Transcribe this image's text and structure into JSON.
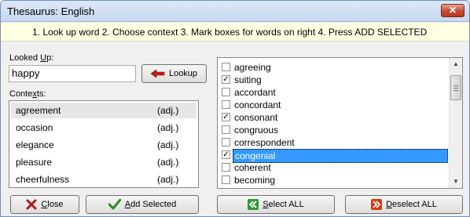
{
  "window": {
    "title": "Thesaurus: English",
    "close_glyph": "✕"
  },
  "instructions": "1. Look up word  2. Choose context  3. Mark boxes for words on right  4. Press ADD SELECTED",
  "lookup": {
    "label_pre": "Looked ",
    "label_key": "U",
    "label_post": "p:",
    "value": "happy",
    "button_label": "Lookup"
  },
  "contexts": {
    "label_pre": "Conte",
    "label_key": "x",
    "label_post": "ts:",
    "items": [
      {
        "word": "agreement",
        "pos": "(adj.)",
        "selected": true
      },
      {
        "word": "occasion",
        "pos": "(adj.)",
        "selected": false
      },
      {
        "word": "elegance",
        "pos": "(adj.)",
        "selected": false
      },
      {
        "word": "pleasure",
        "pos": "(adj.)",
        "selected": false
      },
      {
        "word": "cheerfulness",
        "pos": "(adj.)",
        "selected": false
      }
    ]
  },
  "words": [
    {
      "word": "agreeing",
      "checked": false,
      "selected": false
    },
    {
      "word": "suiting",
      "checked": true,
      "selected": false
    },
    {
      "word": "accordant",
      "checked": false,
      "selected": false
    },
    {
      "word": "concordant",
      "checked": false,
      "selected": false
    },
    {
      "word": "consonant",
      "checked": true,
      "selected": false
    },
    {
      "word": "congruous",
      "checked": false,
      "selected": false
    },
    {
      "word": "correspondent",
      "checked": false,
      "selected": false
    },
    {
      "word": "congenial",
      "checked": true,
      "selected": true
    },
    {
      "word": "coherent",
      "checked": false,
      "selected": false
    },
    {
      "word": "becoming",
      "checked": false,
      "selected": false
    }
  ],
  "buttons": {
    "close": {
      "key": "C",
      "rest": "lose"
    },
    "add_selected": {
      "key": "A",
      "rest": "dd Selected"
    },
    "select_all": {
      "key": "S",
      "rest": "elect ALL"
    },
    "deselect_all": {
      "key": "D",
      "rest": "eselect ALL"
    }
  },
  "colors": {
    "selection": "#3399ff",
    "instructions_bg": "#ffffe1",
    "close_icon": "#b01818",
    "add_icon": "#2a8a2a",
    "select_all_icon": "#2f9a2f",
    "deselect_all_icon": "#d23a10"
  },
  "checkmark_glyph": "✓"
}
